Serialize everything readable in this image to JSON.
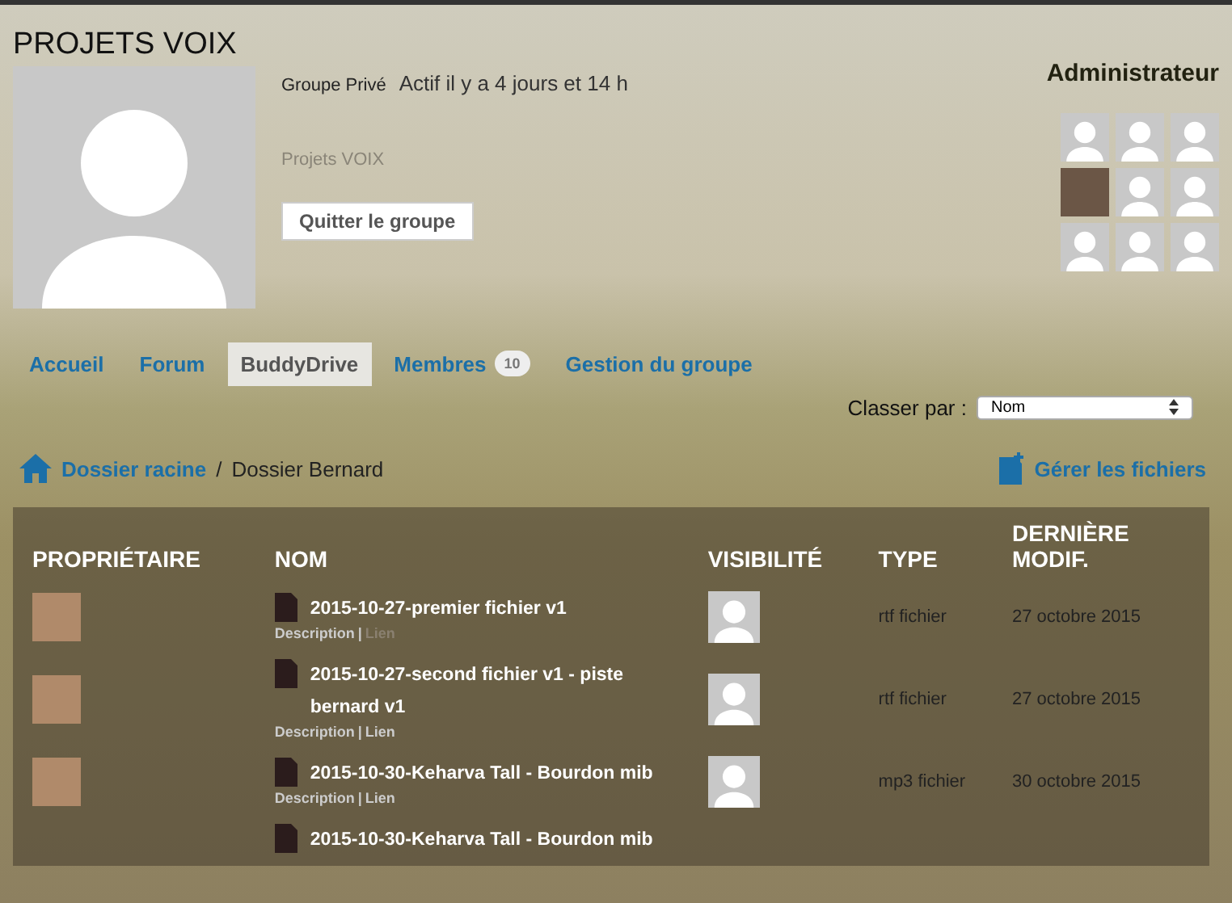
{
  "group": {
    "title": "PROJETS VOIX",
    "status": "Groupe Privé",
    "activity": "Actif il y a 4 jours et 14 h",
    "description": "Projets VOIX",
    "leave_button": "Quitter le groupe"
  },
  "admin": {
    "heading": "Administrateur",
    "avatars": [
      {
        "kind": "default"
      },
      {
        "kind": "default"
      },
      {
        "kind": "default"
      },
      {
        "kind": "photo"
      },
      {
        "kind": "default"
      },
      {
        "kind": "default"
      },
      {
        "kind": "default"
      },
      {
        "kind": "default"
      },
      {
        "kind": "default"
      }
    ]
  },
  "tabs": [
    {
      "label": "Accueil",
      "selected": false
    },
    {
      "label": "Forum",
      "selected": false
    },
    {
      "label": "BuddyDrive",
      "selected": true
    },
    {
      "label": "Membres",
      "selected": false,
      "count": "10"
    },
    {
      "label": "Gestion du groupe",
      "selected": false
    }
  ],
  "sort": {
    "label": "Classer par :",
    "value": "Nom"
  },
  "breadcrumb": {
    "root": "Dossier racine",
    "separator": "/",
    "current": "Dossier Bernard"
  },
  "manage_link": "Gérer les fichiers",
  "table": {
    "columns": [
      "PROPRIÉTAIRE",
      "NOM",
      "VISIBILITÉ",
      "TYPE",
      "DERNIÈRE MODIF."
    ],
    "rows": [
      {
        "name": "2015-10-27-premier fichier v1",
        "description": "Description",
        "separator": "|",
        "link": "Lien",
        "link_enabled": false,
        "type": "rtf fichier",
        "date": "27 octobre 2015"
      },
      {
        "name": "2015-10-27-second fichier v1 - piste bernard v1",
        "description": "Description",
        "separator": "|",
        "link": "Lien",
        "link_enabled": true,
        "type": "rtf fichier",
        "date": "27 octobre 2015"
      },
      {
        "name": "2015-10-30-Keharva Tall - Bourdon mib",
        "description": "Description",
        "separator": "|",
        "link": "Lien",
        "link_enabled": true,
        "type": "mp3 fichier",
        "date": "30 octobre 2015"
      },
      {
        "name": "2015-10-30-Keharva Tall - Bourdon mib"
      }
    ]
  }
}
